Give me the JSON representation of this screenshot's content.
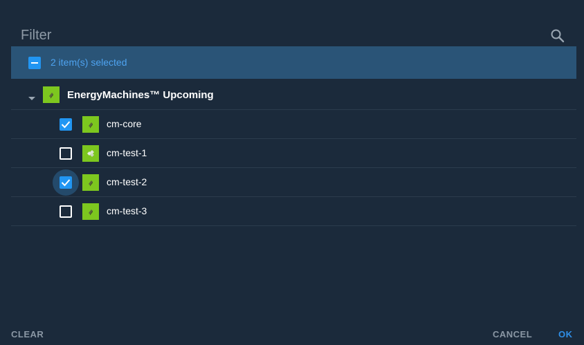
{
  "filter": {
    "placeholder": "Filter"
  },
  "selection": {
    "state": "indeterminate",
    "count_text": "2 item(s) selected"
  },
  "tree": {
    "group": {
      "label": "EnergyMachines™ Upcoming",
      "expanded": true
    },
    "items": [
      {
        "label": "cm-core",
        "checked": true
      },
      {
        "label": "cm-test-1",
        "checked": false
      },
      {
        "label": "cm-test-2",
        "checked": true,
        "focused": true
      },
      {
        "label": "cm-test-3",
        "checked": false
      }
    ]
  },
  "footer": {
    "clear_label": "CLEAR",
    "cancel_label": "CANCEL",
    "ok_label": "OK"
  },
  "colors": {
    "background": "#1b2a3b",
    "selection_bar": "#2a5477",
    "accent_blue": "#2196f3",
    "app_icon_green": "#7dc71f"
  }
}
